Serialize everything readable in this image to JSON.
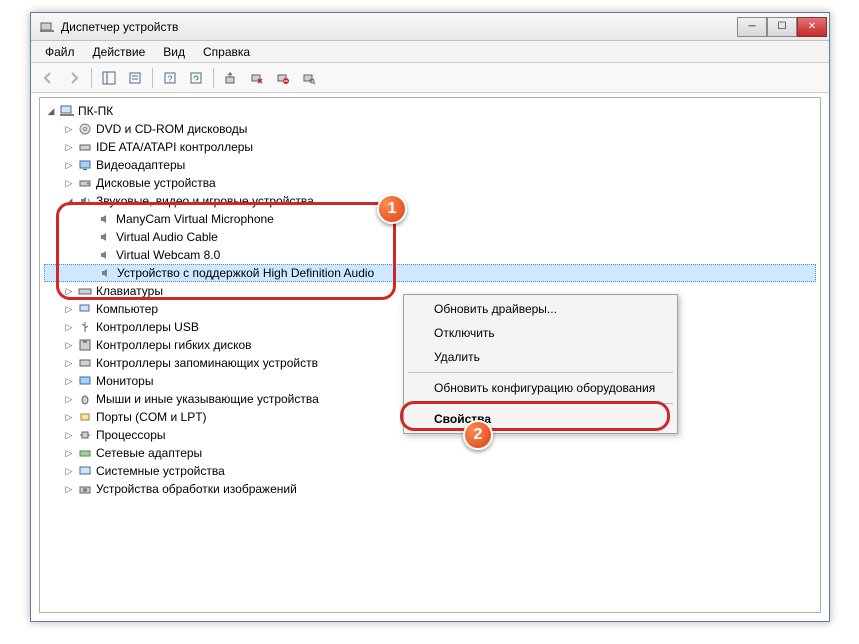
{
  "window": {
    "title": "Диспетчер устройств"
  },
  "menu": {
    "file": "Файл",
    "action": "Действие",
    "view": "Вид",
    "help": "Справка"
  },
  "tree": {
    "root": "ПК-ПК",
    "nodes": {
      "dvd": "DVD и CD-ROM дисководы",
      "ide": "IDE ATA/ATAPI контроллеры",
      "video": "Видеоадаптеры",
      "disk": "Дисковые устройства",
      "sound": "Звуковые, видео и игровые устройства",
      "sound_children": {
        "manycam": "ManyCam Virtual Microphone",
        "vac": "Virtual Audio Cable",
        "webcam": "Virtual Webcam 8.0",
        "hda": "Устройство с поддержкой High Definition Audio"
      },
      "keyboard": "Клавиатуры",
      "computer": "Компьютер",
      "usb": "Контроллеры USB",
      "floppy": "Контроллеры гибких дисков",
      "storage": "Контроллеры запоминающих устройств",
      "monitor": "Мониторы",
      "mouse": "Мыши и иные указывающие устройства",
      "ports": "Порты (COM и LPT)",
      "cpu": "Процессоры",
      "net": "Сетевые адаптеры",
      "system": "Системные устройства",
      "imaging": "Устройства обработки изображений"
    }
  },
  "context_menu": {
    "update": "Обновить драйверы...",
    "disable": "Отключить",
    "delete": "Удалить",
    "scan": "Обновить конфигурацию оборудования",
    "properties": "Свойства"
  },
  "badges": {
    "one": "1",
    "two": "2"
  }
}
